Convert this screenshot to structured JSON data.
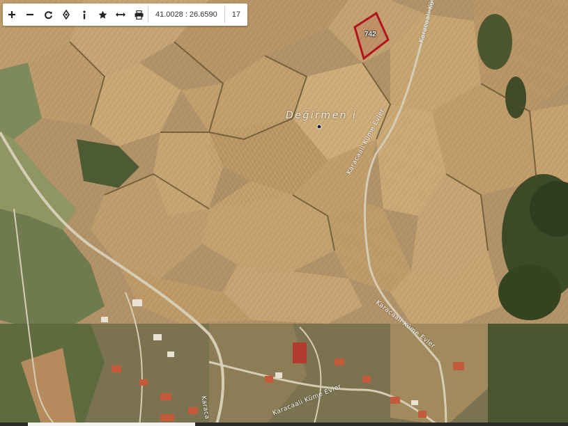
{
  "toolbar": {
    "buttons": [
      {
        "name": "zoom-in",
        "icon": "plus-icon"
      },
      {
        "name": "zoom-out",
        "icon": "minus-icon"
      },
      {
        "name": "refresh",
        "icon": "refresh-icon"
      },
      {
        "name": "locate",
        "icon": "crosshair-icon"
      },
      {
        "name": "info",
        "icon": "info-icon"
      },
      {
        "name": "favorite",
        "icon": "star-icon"
      },
      {
        "name": "measure",
        "icon": "measure-icon"
      },
      {
        "name": "print",
        "icon": "print-icon"
      }
    ],
    "coordinates": "41.0028 : 26.6590",
    "zoom": "17"
  },
  "map": {
    "place_name": "Değirmen i",
    "parcel_number": "742",
    "parcel_color": "#b3121f",
    "street_labels": [
      "Karacaali Küme Evler",
      "Karacaali Küme Evler",
      "Karacaali Küme Evler",
      "Karacaali Küme Evler",
      "Karacaali Kü",
      "Karaca"
    ]
  }
}
